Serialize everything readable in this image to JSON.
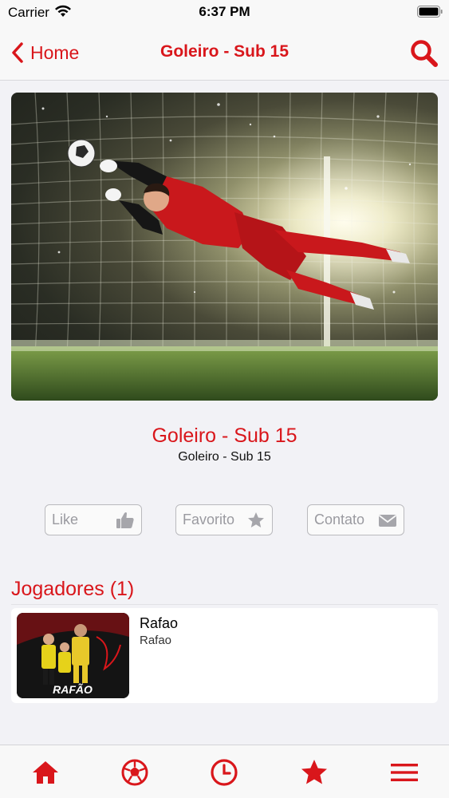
{
  "status_bar": {
    "carrier": "Carrier",
    "time": "6:37 PM"
  },
  "nav": {
    "back_label": "Home",
    "title": "Goleiro - Sub 15"
  },
  "hero": {
    "image_subject": "goalkeeper diving to save a soccer ball"
  },
  "team": {
    "title": "Goleiro - Sub 15",
    "subtitle": "Goleiro - Sub 15"
  },
  "actions": {
    "like_label": "Like",
    "favorite_label": "Favorito",
    "contact_label": "Contato"
  },
  "players": {
    "section_title": "Jogadores (1)",
    "items": [
      {
        "name": "Rafao",
        "subtitle": "Rafao",
        "thumbnail_caption": "RAFÃO"
      }
    ]
  },
  "tabs": [
    "home-icon",
    "soccer-ball-icon",
    "clock-icon",
    "star-icon",
    "menu-icon"
  ],
  "colors": {
    "accent": "#d9161b",
    "background": "#f2f2f6",
    "bar": "#f8f8f8"
  }
}
